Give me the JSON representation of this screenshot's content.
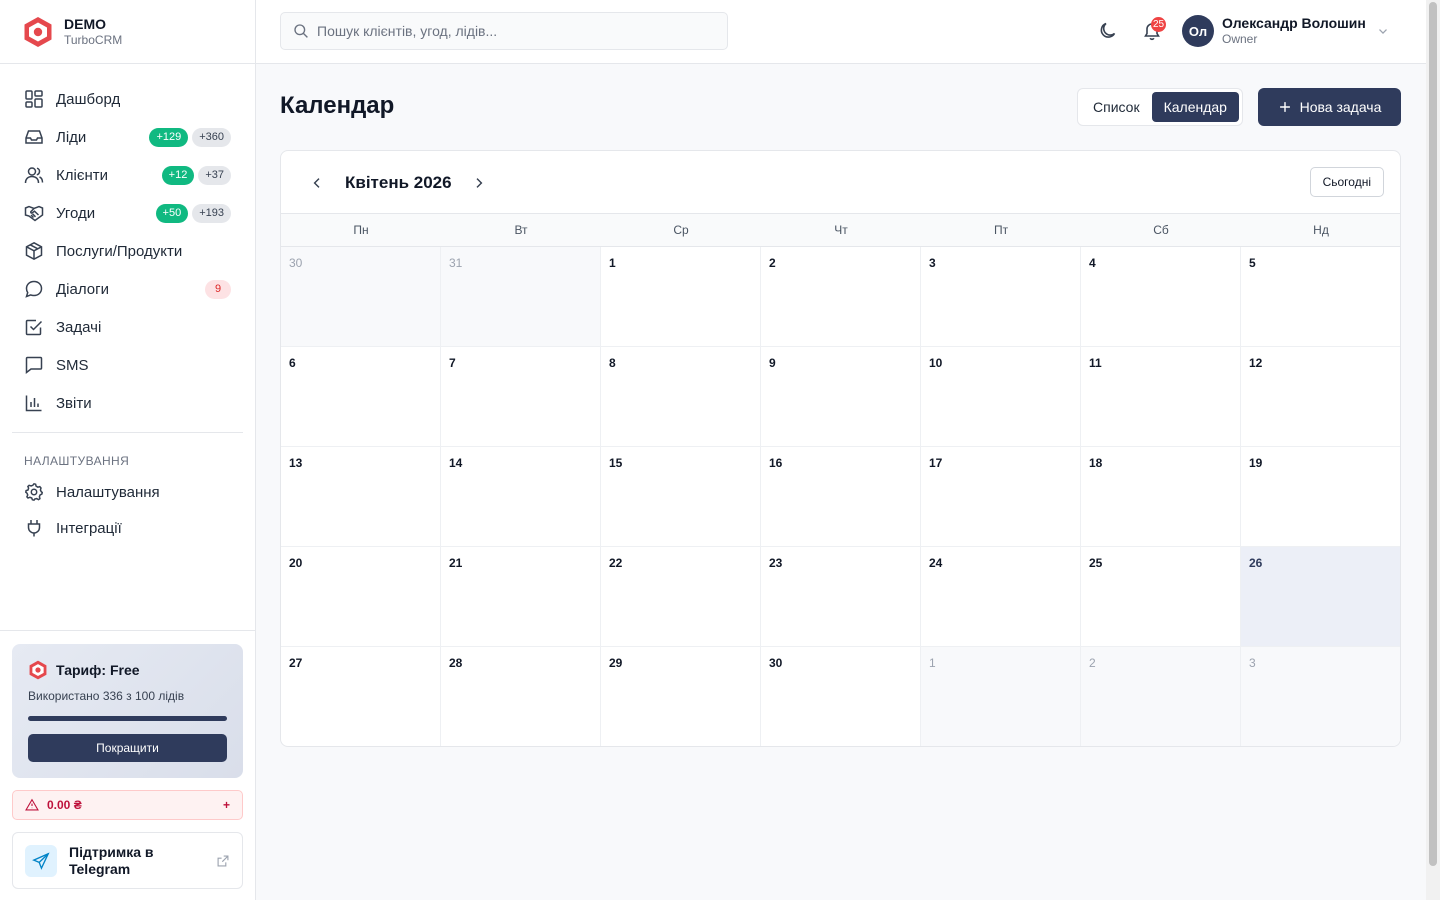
{
  "brand": {
    "name": "DEMO",
    "sub": "TurboCRM"
  },
  "nav": [
    {
      "label": "Дашборд",
      "icon": "dashboard-icon"
    },
    {
      "label": "Ліди",
      "icon": "inbox-icon",
      "badge_new": "+129",
      "badge_total": "+360"
    },
    {
      "label": "Клієнти",
      "icon": "users-icon",
      "badge_new": "+12",
      "badge_total": "+37"
    },
    {
      "label": "Угоди",
      "icon": "handshake-icon",
      "badge_new": "+50",
      "badge_total": "+193"
    },
    {
      "label": "Послуги/Продукти",
      "icon": "package-icon"
    },
    {
      "label": "Діалоги",
      "icon": "chat-icon",
      "badge_count": "9"
    },
    {
      "label": "Задачі",
      "icon": "checkbox-icon"
    },
    {
      "label": "SMS",
      "icon": "message-icon"
    },
    {
      "label": "Звіти",
      "icon": "bar-chart-icon"
    }
  ],
  "settings_section": {
    "title": "НАЛАШТУВАННЯ",
    "items": [
      {
        "label": "Налаштування",
        "icon": "gear-icon"
      },
      {
        "label": "Інтеграції",
        "icon": "plug-icon"
      }
    ]
  },
  "plan": {
    "title": "Тариф: Free",
    "usage": "Використано 336 з 100 лідів",
    "usage_fraction": 1.0,
    "upgrade_label": "Покращити"
  },
  "balance": {
    "amount": "0.00 ₴",
    "add": "+"
  },
  "support": {
    "label": "Підтримка в Telegram"
  },
  "topbar": {
    "search_placeholder": "Пошук клієнтів, угод, лідів...",
    "notifications": "25",
    "user_initials": "Ол",
    "user_name": "Олександр Волошин",
    "user_role": "Owner"
  },
  "page": {
    "title": "Календар",
    "view_list": "Список",
    "view_calendar": "Календар",
    "new_task": "Нова задача"
  },
  "calendar": {
    "month": "Квітень 2026",
    "today_label": "Сьогодні",
    "weekdays": [
      "Пн",
      "Вт",
      "Ср",
      "Чт",
      "Пт",
      "Сб",
      "Нд"
    ],
    "days": [
      {
        "d": "30",
        "muted": true
      },
      {
        "d": "31",
        "muted": true
      },
      {
        "d": "1"
      },
      {
        "d": "2"
      },
      {
        "d": "3"
      },
      {
        "d": "4"
      },
      {
        "d": "5"
      },
      {
        "d": "6"
      },
      {
        "d": "7"
      },
      {
        "d": "8"
      },
      {
        "d": "9"
      },
      {
        "d": "10"
      },
      {
        "d": "11"
      },
      {
        "d": "12"
      },
      {
        "d": "13"
      },
      {
        "d": "14"
      },
      {
        "d": "15"
      },
      {
        "d": "16"
      },
      {
        "d": "17"
      },
      {
        "d": "18"
      },
      {
        "d": "19"
      },
      {
        "d": "20"
      },
      {
        "d": "21"
      },
      {
        "d": "22"
      },
      {
        "d": "23"
      },
      {
        "d": "24"
      },
      {
        "d": "25"
      },
      {
        "d": "26",
        "today": true
      },
      {
        "d": "27"
      },
      {
        "d": "28"
      },
      {
        "d": "29"
      },
      {
        "d": "30"
      },
      {
        "d": "1",
        "muted": true
      },
      {
        "d": "2",
        "muted": true
      },
      {
        "d": "3",
        "muted": true
      }
    ]
  },
  "colors": {
    "primary": "#2f3b5c",
    "success": "#10b981",
    "danger": "#ef4444",
    "brand_red": "#e53e3e"
  }
}
